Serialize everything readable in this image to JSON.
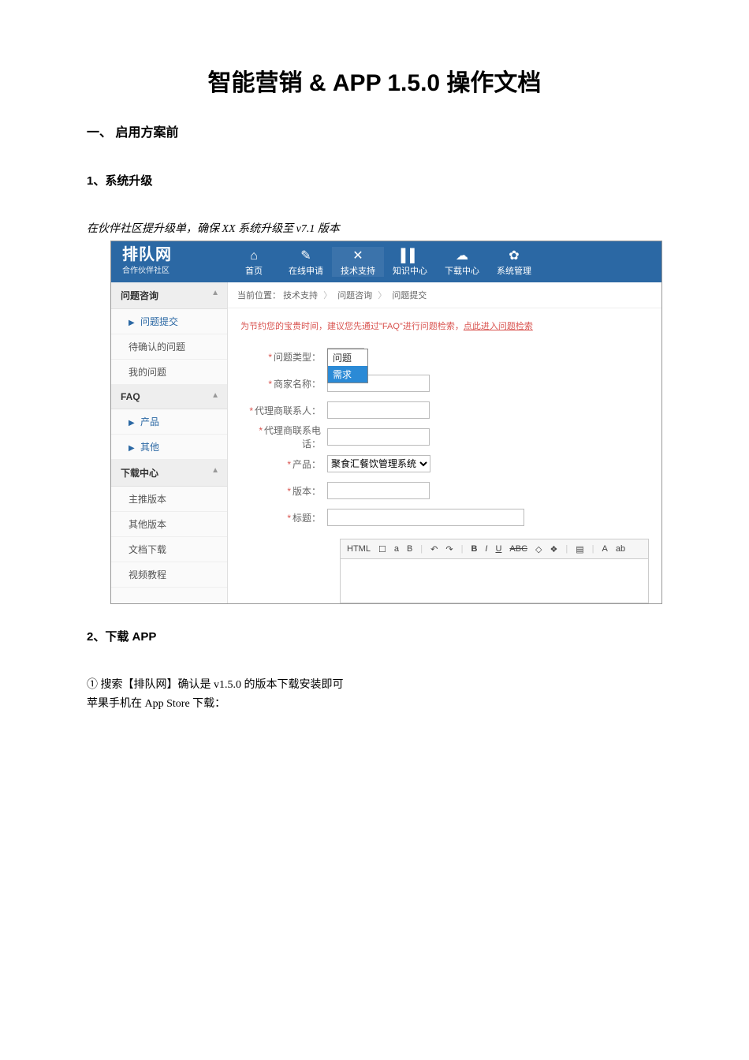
{
  "doc": {
    "title": "智能营销 & APP 1.5.0 操作文档",
    "h1_1": "一、  启用方案前",
    "h2_1": "1、系统升级",
    "p1": "在伙伴社区提升级单，确保 XX 系统升级至 v7.1 版本",
    "h2_2": "2、下载 APP",
    "p2": "① 搜索【排队网】确认是 v1.5.0 的版本下载安装即可",
    "p3": "苹果手机在 App Store 下载："
  },
  "shot": {
    "logo_main": "排队网",
    "logo_sub": "合作伙伴社区",
    "nav": [
      {
        "icon": "⌂",
        "label": "首页"
      },
      {
        "icon": "✎",
        "label": "在线申请"
      },
      {
        "icon": "✕",
        "label": "技术支持"
      },
      {
        "icon": "▌▌",
        "label": "知识中心"
      },
      {
        "icon": "☁",
        "label": "下载中心"
      },
      {
        "icon": "✿",
        "label": "系统管理"
      }
    ],
    "side": {
      "g1": "问题咨询",
      "g1_items": [
        "问题提交",
        "待确认的问题",
        "我的问题"
      ],
      "g2": "FAQ",
      "g2_items": [
        "产品",
        "其他"
      ],
      "g3": "下载中心",
      "g3_items": [
        "主推版本",
        "其他版本",
        "文档下载",
        "视频教程"
      ]
    },
    "crumb": {
      "prefix": "当前位置：",
      "a": "技术支持",
      "b": "问题咨询",
      "c": "问题提交"
    },
    "tip": {
      "text": "为节约您的宝贵时间，建议您先通过\"FAQ\"进行问题检索，",
      "link": "点此进入问题检索"
    },
    "form": {
      "type_label": "问题类型：",
      "type_value": "问题",
      "type_options": [
        "问题",
        "需求"
      ],
      "merchant_label": "商家名称：",
      "agent_label": "代理商联系人：",
      "agent_phone_label": "代理商联系电话：",
      "product_label": "产品：",
      "product_value": "聚食汇餐饮管理系统",
      "version_label": "版本：",
      "title_label": "标题："
    },
    "editor": {
      "btns": [
        "HTML",
        "☐",
        "a",
        "B",
        "↶",
        "↷",
        "B",
        "I",
        "U",
        "ABC",
        "◇",
        "❖",
        "▤",
        "A",
        "ab"
      ]
    }
  }
}
